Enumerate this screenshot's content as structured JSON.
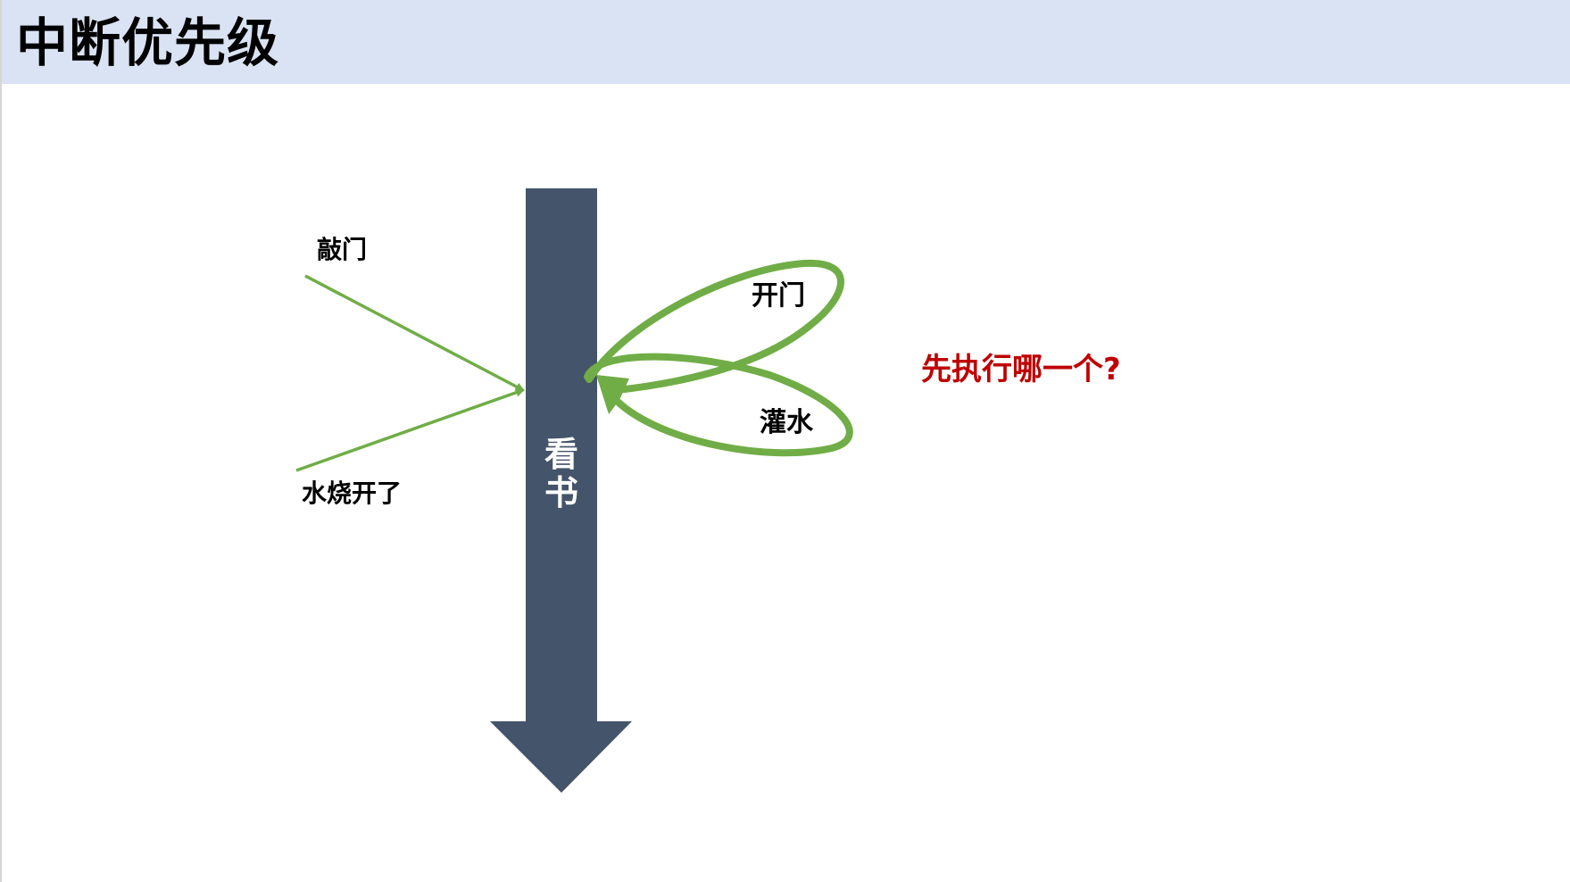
{
  "slide": {
    "title": "中断优先级"
  },
  "diagram": {
    "main_arrow": {
      "label_line1": "看",
      "label_line2": "书",
      "color": "#44546a"
    },
    "inputs": [
      {
        "label": "敲门"
      },
      {
        "label": "水烧开了"
      }
    ],
    "loops": [
      {
        "label": "开门"
      },
      {
        "label": "灌水"
      }
    ],
    "connector_color": "#70ad47",
    "question": {
      "text": "先执行哪一个?",
      "color": "#c00000"
    }
  }
}
